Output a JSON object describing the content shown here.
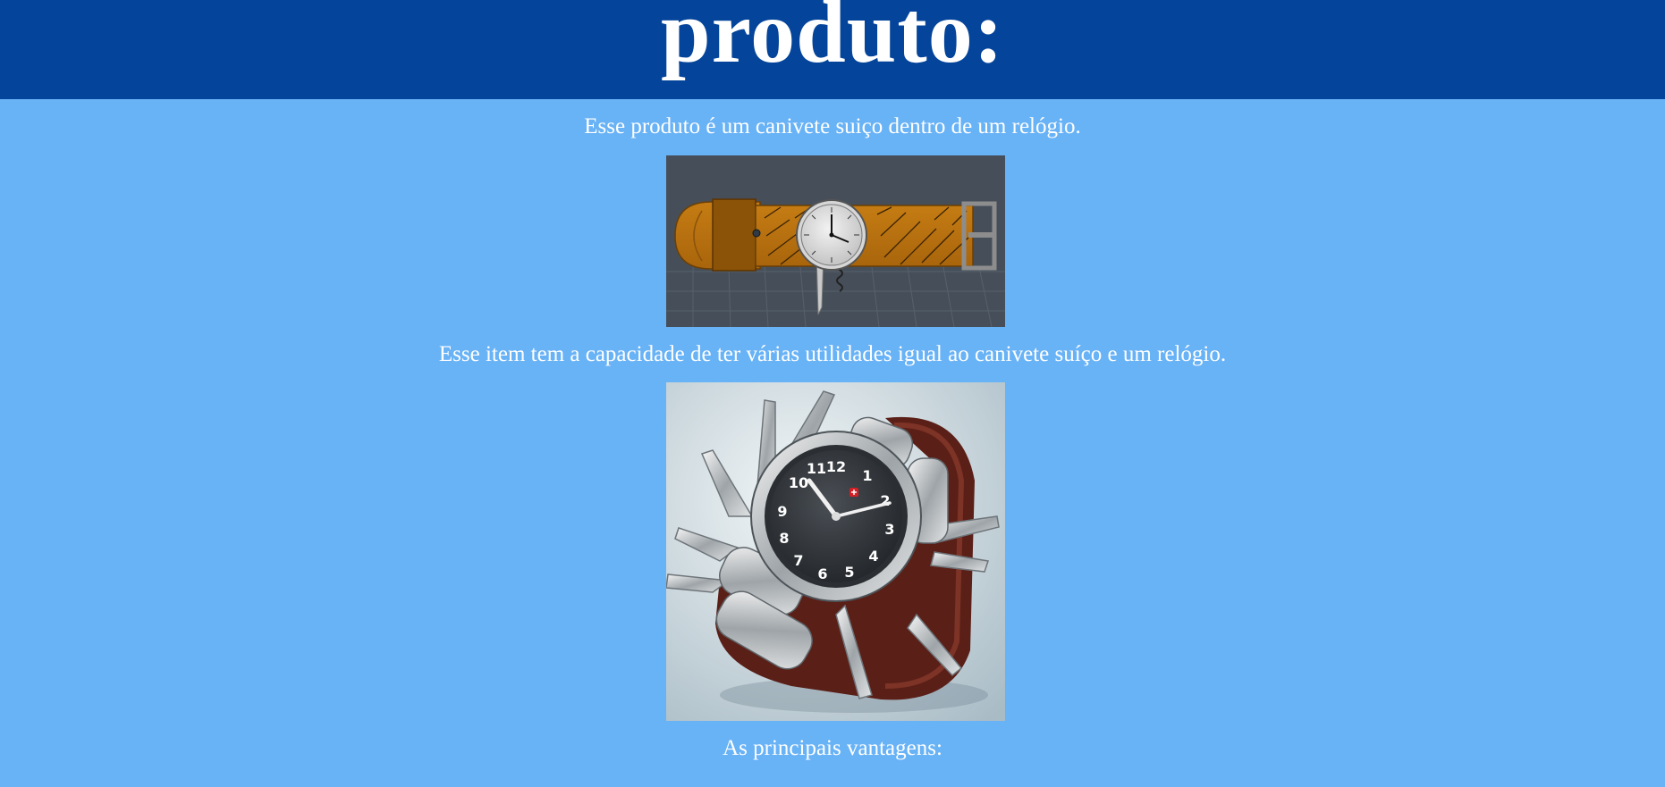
{
  "header": {
    "title": "produto:"
  },
  "content": {
    "paragraph_1": "Esse produto é um canivete suiço dentro de um relógio.",
    "paragraph_2": "Esse item tem a capacidade de ter várias utilidades igual ao canivete suíço e um relógio.",
    "paragraph_3": "As principais vantagens:"
  },
  "images": {
    "product_render_icon": "watch-knife-render-image",
    "product_photo_icon": "watch-knife-photo-image"
  },
  "colors": {
    "header_background": "#04449a",
    "page_background": "#68b2f6",
    "text": "#ffffff"
  }
}
